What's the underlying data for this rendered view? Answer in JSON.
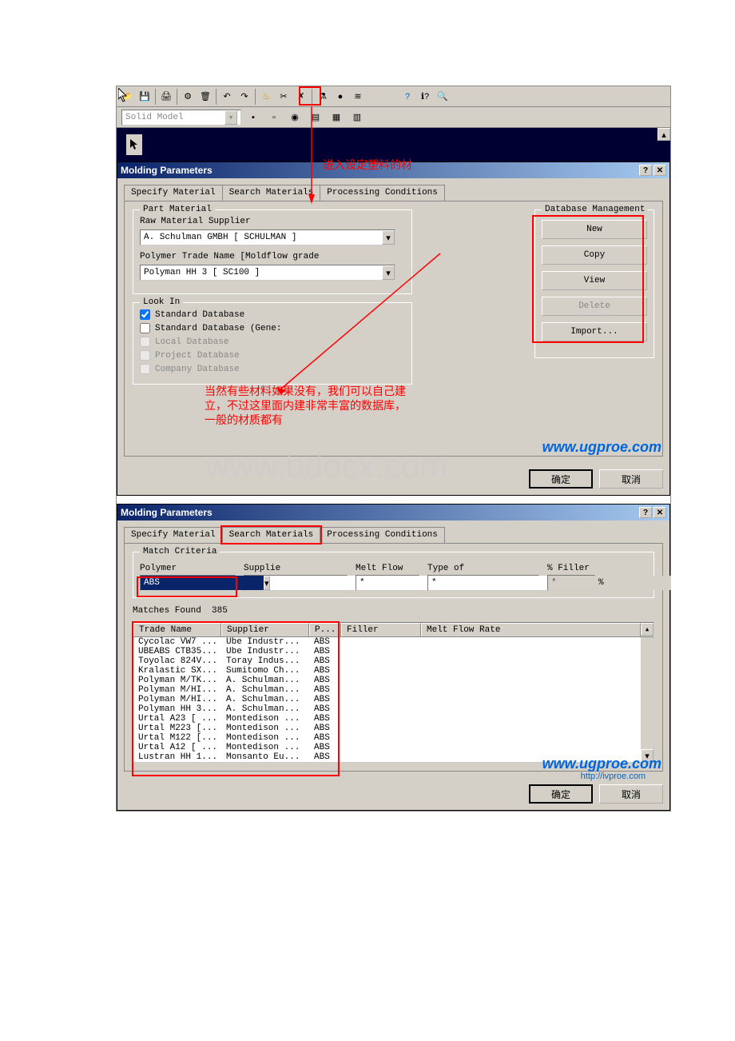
{
  "toolbar2_select": "Solid Model",
  "annotations": {
    "enter_material": "进入设定塑料的材",
    "custom_material": "当然有些材料如果没有，我们可以自己建立，不过这里面内建非常丰富的数据库，一般的材质都有"
  },
  "dialog1": {
    "title": "Molding Parameters",
    "tabs": [
      "Specify Material",
      "Search Materials",
      "Processing Conditions"
    ],
    "part_material": {
      "legend": "Part Material",
      "supplier_label": "Raw Material Supplier",
      "supplier_value": "A. Schulman GMBH [ SCHULMAN ]",
      "trade_label": "Polymer Trade Name [Moldflow grade",
      "trade_value": "Polyman HH 3 [ SC100 ]"
    },
    "look_in": {
      "legend": "Look In",
      "opts": [
        "Standard Database",
        "Standard Database (Gene:",
        "Local Database",
        "Project Database",
        "Company Database"
      ]
    },
    "db_mgmt": {
      "legend": "Database Management",
      "btns": [
        "New",
        "Copy",
        "View",
        "Delete",
        "Import..."
      ]
    },
    "ok": "确定",
    "cancel": "取消"
  },
  "dialog2": {
    "title": "Molding Parameters",
    "tabs": [
      "Specify Material",
      "Search Materials",
      "Processing Conditions"
    ],
    "match_criteria": {
      "legend": "Match Criteria",
      "cols": {
        "polymer": {
          "label": "Polymer",
          "value": "ABS"
        },
        "supplier": {
          "label": "Supplie",
          "value": "*"
        },
        "meltflow": {
          "label": "Melt Flow",
          "value": "*"
        },
        "typeof": {
          "label": "Type of",
          "value": "*"
        },
        "filler": {
          "label": "% Filler",
          "value": "*",
          "unit": "%"
        }
      }
    },
    "matches_label": "Matches Found",
    "matches_count": "385",
    "columns": [
      "Trade Name",
      "Supplier",
      "P...",
      "Filler",
      "Melt Flow Rate"
    ],
    "rows": [
      {
        "trade": "Cycolac VW7 ...",
        "supplier": "Ube Industr...",
        "p": "ABS"
      },
      {
        "trade": "UBEABS CTB35...",
        "supplier": "Ube Industr...",
        "p": "ABS"
      },
      {
        "trade": "Toyolac 824V...",
        "supplier": "Toray Indus...",
        "p": "ABS"
      },
      {
        "trade": "Kralastic SX...",
        "supplier": "Sumitomo Ch...",
        "p": "ABS"
      },
      {
        "trade": "Polyman M/TK...",
        "supplier": "A. Schulman...",
        "p": "ABS"
      },
      {
        "trade": "Polyman M/HI...",
        "supplier": "A. Schulman...",
        "p": "ABS"
      },
      {
        "trade": "Polyman M/HI...",
        "supplier": "A. Schulman...",
        "p": "ABS"
      },
      {
        "trade": "Polyman HH 3...",
        "supplier": "A. Schulman...",
        "p": "ABS"
      },
      {
        "trade": "Urtal A23 [ ...",
        "supplier": "Montedison ...",
        "p": "ABS"
      },
      {
        "trade": "Urtal M223 [...",
        "supplier": "Montedison ...",
        "p": "ABS"
      },
      {
        "trade": "Urtal M122 [...",
        "supplier": "Montedison ...",
        "p": "ABS"
      },
      {
        "trade": "Urtal A12 [ ...",
        "supplier": "Montedison ...",
        "p": "ABS"
      },
      {
        "trade": "Lustran HH 1...",
        "supplier": "Monsanto Eu...",
        "p": "ABS"
      }
    ],
    "ok": "确定",
    "cancel": "取消"
  },
  "watermarks": {
    "bdocx": "www.bdocx.com",
    "ugproe": "www.ugproe.com",
    "http": "http://ivproe.com"
  }
}
